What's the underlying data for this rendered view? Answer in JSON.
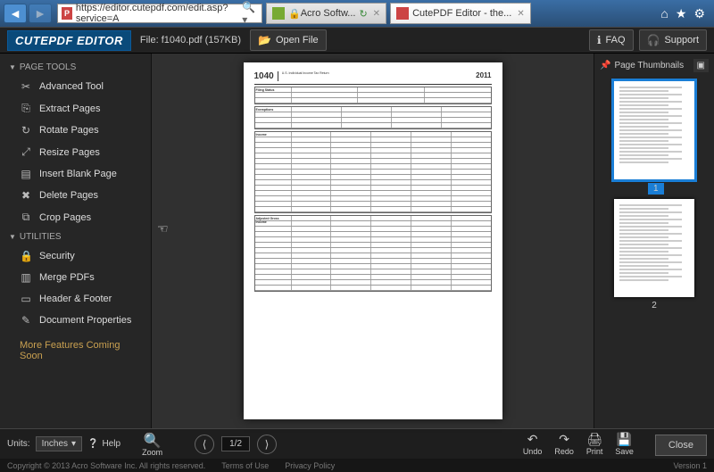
{
  "browser": {
    "url_display": "https://editor.cutepdf.com/edit.asp?service=A",
    "tabs": [
      {
        "label": "Acro Softw..."
      },
      {
        "label": "CutePDF Editor - the..."
      }
    ]
  },
  "app": {
    "logo": "CUTEPDF EDITOR",
    "file_label": "File: f1040.pdf (157KB)",
    "open_file": "Open File",
    "faq": "FAQ",
    "support": "Support"
  },
  "sidebar": {
    "sections": {
      "page_tools": "PAGE TOOLS",
      "utilities": "UTILITIES"
    },
    "page_tools": [
      {
        "icon": "✂",
        "label": "Advanced Tool"
      },
      {
        "icon": "⎘",
        "label": "Extract Pages"
      },
      {
        "icon": "↻",
        "label": "Rotate Pages"
      },
      {
        "icon": "⤢",
        "label": "Resize Pages"
      },
      {
        "icon": "▤",
        "label": "Insert Blank Page"
      },
      {
        "icon": "✖",
        "label": "Delete Pages"
      },
      {
        "icon": "⧉",
        "label": "Crop Pages"
      }
    ],
    "utilities": [
      {
        "icon": "🔒",
        "label": "Security"
      },
      {
        "icon": "▥",
        "label": "Merge PDFs"
      },
      {
        "icon": "▭",
        "label": "Header & Footer"
      },
      {
        "icon": "✎",
        "label": "Document Properties"
      }
    ],
    "coming_soon": "More Features Coming Soon"
  },
  "document": {
    "form_number": "1040",
    "form_title": "U.S. Individual Income Tax Return",
    "year": "2011",
    "section_labels": [
      "Filing Status",
      "Exemptions",
      "Income",
      "Adjusted Gross Income"
    ]
  },
  "thumbnails": {
    "header": "Page Thumbnails",
    "pages": [
      {
        "num": "1",
        "selected": true
      },
      {
        "num": "2",
        "selected": false
      }
    ]
  },
  "bottom": {
    "units_label": "Units:",
    "units_value": "Inches",
    "help": "Help",
    "zoom": "Zoom",
    "page_counter": "1/2",
    "actions": {
      "undo": "Undo",
      "redo": "Redo",
      "print": "Print",
      "save": "Save"
    },
    "close": "Close"
  },
  "footer": {
    "copyright": "Copyright © 2013 Acro Software Inc. All rights reserved.",
    "terms": "Terms of Use",
    "privacy": "Privacy Policy",
    "version": "Version 1"
  }
}
